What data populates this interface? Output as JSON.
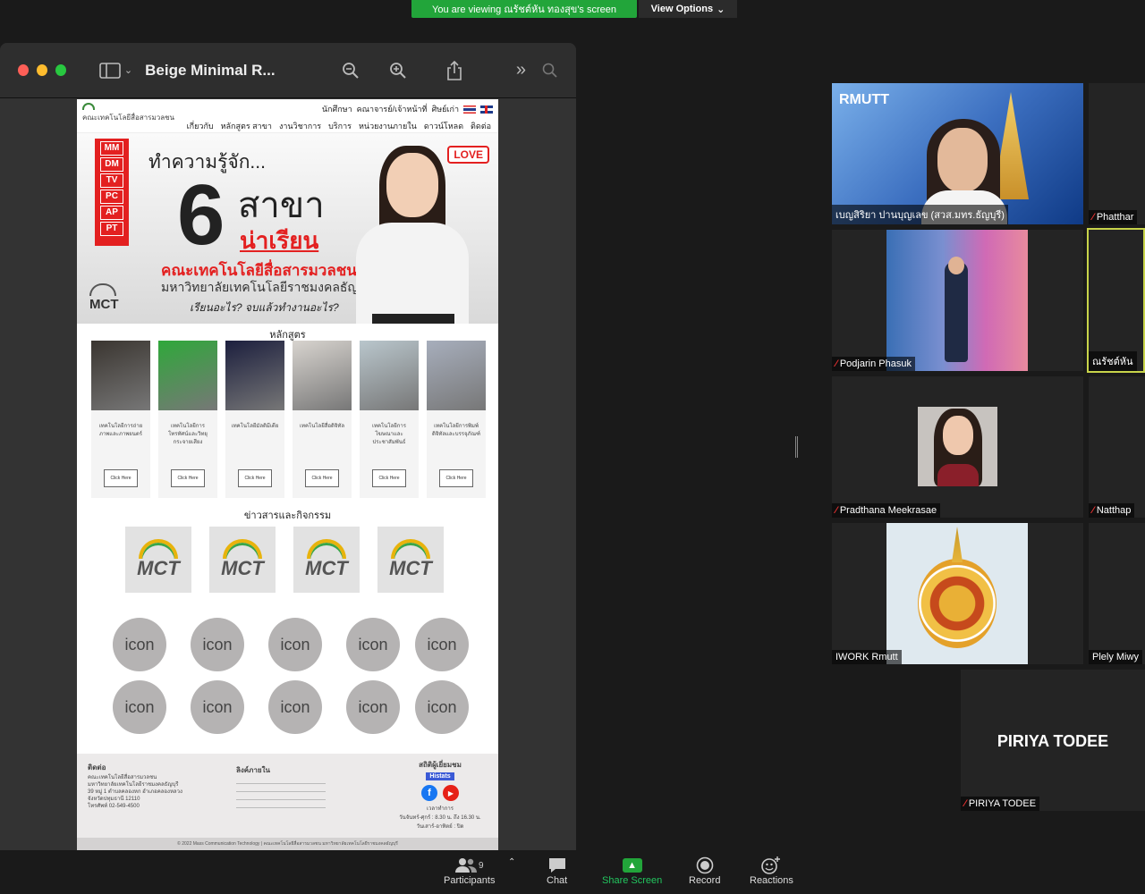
{
  "banner": {
    "text": "You are viewing ณรัชต์หัน  ทองสุข's screen",
    "view_options": "View Options"
  },
  "window": {
    "title": "Beige Minimal R..."
  },
  "site": {
    "logo_text": "คณะเทคโนโลยีสื่อสารมวลชน",
    "top_links": [
      "นักศึกษา",
      "คณาจารย์/เจ้าหน้าที่",
      "ศิษย์เก่า"
    ],
    "nav": [
      "เกี่ยวกับ",
      "หลักสูตร สาขา",
      "งานวิชาการ",
      "บริการ",
      "หน่วยงานภายใน",
      "ดาวน์โหลด",
      "ติดต่อ"
    ],
    "hero": {
      "tags": [
        "MM",
        "DM",
        "TV",
        "PC",
        "AP",
        "PT"
      ],
      "intro": "ทำความรู้จัก...",
      "number": "6",
      "sakha": "สาขา",
      "naarian": "น่าเรียน",
      "faculty": "คณะเทคโนโลยีสื่อสารมวลชน",
      "university": "มหาวิทยาลัยเทคโนโลยีราชมงคลธัญบุรี",
      "question": "เรียนอะไร? จบแล้วทำงานอะไร?",
      "love": "LOVE",
      "mct": "MCT"
    },
    "courses_title": "หลักสูตร",
    "courses": [
      {
        "caption": "เทคโนโลยีการถ่ายภาพและภาพยนตร์",
        "button": "Click Here",
        "color": "#3a3530"
      },
      {
        "caption": "เทคโนโลยีการโทรทัศน์และวิทยุกระจายเสียง",
        "button": "Click Here",
        "color": "#2fa83a"
      },
      {
        "caption": "เทคโนโลยีมัลติมีเดีย",
        "button": "Click Here",
        "color": "#1c1f3e"
      },
      {
        "caption": "เทคโนโลยีสื่อดิจิทัล",
        "button": "Click Here",
        "color": "#d8d4cf"
      },
      {
        "caption": "เทคโนโลยีการโฆษณาและประชาสัมพันธ์",
        "button": "Click Here",
        "color": "#b9c6cc"
      },
      {
        "caption": "เทคโนโลยีการพิมพ์ดิจิทัลและบรรจุภัณฑ์",
        "button": "Click Here",
        "color": "#a7aebc"
      }
    ],
    "news_title": "ข่าวสารและกิจกรรม",
    "news": [
      "MCT",
      "MCT",
      "MCT",
      "MCT"
    ],
    "icons": [
      "icon",
      "icon",
      "icon",
      "icon",
      "icon",
      "icon",
      "icon",
      "icon",
      "icon",
      "icon"
    ],
    "footer": {
      "contact_title": "ติดต่อ",
      "contact_lines": [
        "คณะเทคโนโลยีสื่อสารมวลชน",
        "มหาวิทยาลัยเทคโนโลยีราชมงคลธัญบุรี",
        "39 หมู่ 1 ตำบลคลองหก อำเภอคลองหลวง",
        "จังหวัดปทุมธานี 12110",
        "โทรศัพท์ 02-549-4500"
      ],
      "links_title": "ลิงค์ภายใน",
      "stats_title": "สถิติผู้เยี่ยมชม",
      "histats": "Histats",
      "fb": "f",
      "yt": "▶",
      "hours_title": "เวลาทำการ",
      "hours_lines": [
        "วันจันทร์-ศุกร์ : 8.30 น. ถึง 16.30 น.",
        "วันเสาร์-อาทิตย์ : ปิด"
      ],
      "copyright": "© 2022 Mass Communication Technology | คณะเทคโนโลยีสื่อสารมวลชน มหาวิทยาลัยเทคโนโลยีราชมงคลธัญบุรี"
    }
  },
  "participants": [
    {
      "name": "เบญสิริยา ปานบุญเลข (สวส.มทร.ธัญบุรี)",
      "muted": false
    },
    {
      "name": "Phatthar",
      "muted": true
    },
    {
      "name": "Podjarin Phasuk",
      "muted": true
    },
    {
      "name": "ณรัชต์หัน",
      "muted": false
    },
    {
      "name": "Pradthana Meekrasae",
      "muted": true
    },
    {
      "name": "Natthap",
      "muted": true
    },
    {
      "name": "IWORK Rmutt",
      "muted": false
    },
    {
      "name": "Plely Miwy",
      "muted": false
    },
    {
      "name": "PIRIYA TODEE",
      "muted": true,
      "big": "PIRIYA TODEE"
    }
  ],
  "toolbar": {
    "participants": "Participants",
    "participants_count": "9",
    "chat": "Chat",
    "share": "Share Screen",
    "record": "Record",
    "reactions": "Reactions"
  }
}
